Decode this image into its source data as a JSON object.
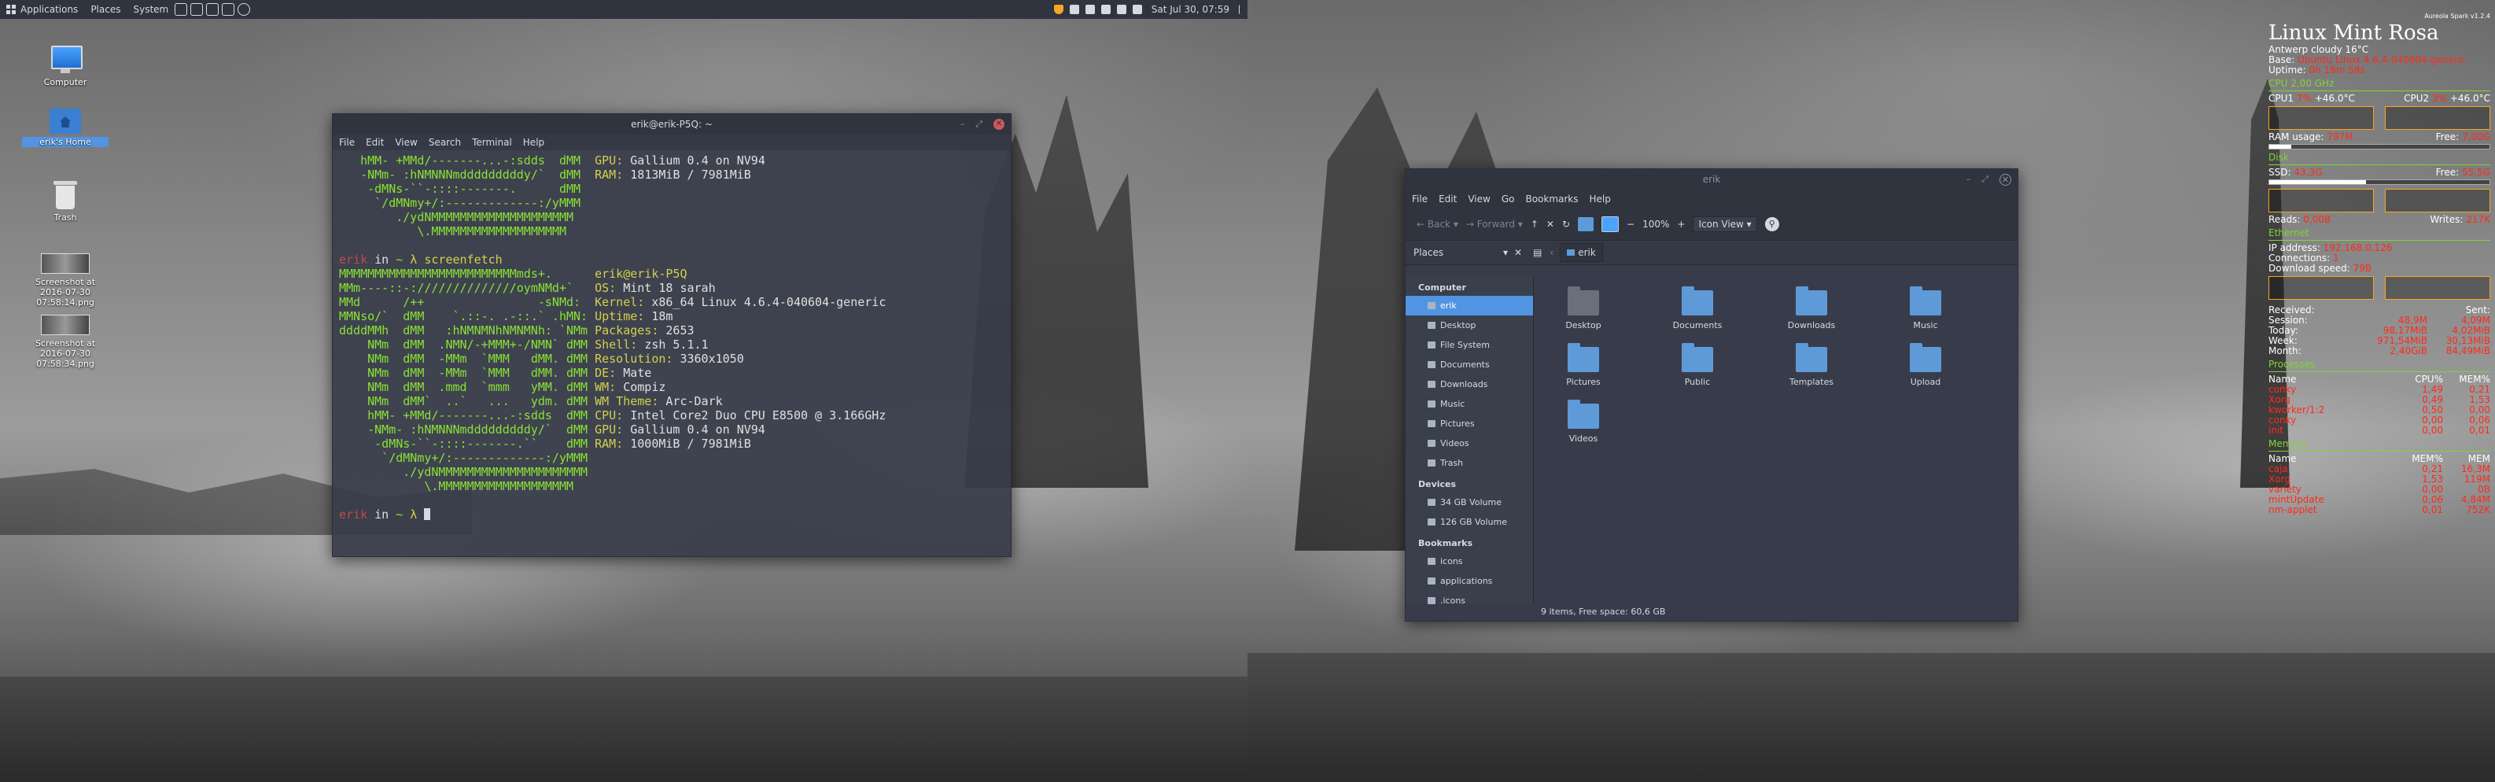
{
  "panel": {
    "applications": "Applications",
    "places": "Places",
    "system": "System",
    "clock": "Sat Jul 30, 07:59"
  },
  "desktop": {
    "icons": [
      {
        "label": "Computer"
      },
      {
        "label": "erik's Home"
      },
      {
        "label": "Trash"
      },
      {
        "label": "Screenshot at 2016-07-30 07:58:14.png"
      },
      {
        "label": "Screenshot at 2016-07-30 07:58:34.png"
      }
    ]
  },
  "terminal": {
    "title": "erik@erik-P5Q: ~",
    "menu": [
      "File",
      "Edit",
      "View",
      "Search",
      "Terminal",
      "Help"
    ],
    "top_lines": [
      [
        "   hMM- +MMd/-------...-:sdds  dMM  ",
        "GPU: ",
        "Gallium 0.4 on NV94"
      ],
      [
        "   -NMm- :hNMNNNmdddddddddy/`  dMM  ",
        "RAM: ",
        "1813MiB / 7981MiB"
      ],
      [
        "    -dMNs-``-::::-------.      dMM",
        "",
        ""
      ],
      [
        "     `/dMNmy+/:-------------:/yMMM",
        "",
        ""
      ],
      [
        "        ./ydNMMMMMMMMMMMMMMMMMMMM",
        "",
        ""
      ],
      [
        "           \\.MMMMMMMMMMMMMMMMMMM",
        "",
        ""
      ]
    ],
    "prompt1_user": "erik",
    "prompt1_mid": " in ",
    "prompt1_tilde": "~",
    "prompt1_cmd": " λ screenfetch",
    "userhost": "erik@erik-P5Q",
    "logo": [
      "MMMMMMMMMMMMMMMMMMMMMMMMMmds+.",
      "MMm----::-://////////////oymNMd+`",
      "MMd      /++                -sNMd:",
      "MMNso/`  dMM    `.::-. .-::.` .hMN:",
      "ddddMMh  dMM   :hNMNMNhNMNMNh: `NMm",
      "    NMm  dMM  .NMN/-+MMM+-/NMN` dMM",
      "    NMm  dMM  -MMm  `MMM   dMM. dMM",
      "    NMm  dMM  -MMm  `MMM   dMM. dMM",
      "    NMm  dMM  .mmd  `mmm   yMM. dMM",
      "    NMm  dMM`  ..`   ...   ydm. dMM",
      "    hMM- +MMd/-------...-:sdds  dMM",
      "    -NMm- :hNMNNNmdddddddddy/`  dMM",
      "     -dMNs-``-::::-------.``    dMM",
      "      `/dMNmy+/:-------------:/yMMM",
      "         ./ydNMMMMMMMMMMMMMMMMMMMMM",
      "            \\.MMMMMMMMMMMMMMMMMMM"
    ],
    "info": [
      [
        "",
        ""
      ],
      [
        "OS: ",
        "Mint 18 sarah"
      ],
      [
        "Kernel: ",
        "x86_64 Linux 4.6.4-040604-generic"
      ],
      [
        "Uptime: ",
        "18m"
      ],
      [
        "Packages: ",
        "2653"
      ],
      [
        "Shell: ",
        "zsh 5.1.1"
      ],
      [
        "Resolution: ",
        "3360x1050"
      ],
      [
        "DE: ",
        "Mate"
      ],
      [
        "WM: ",
        "Compiz"
      ],
      [
        "WM Theme: ",
        "Arc-Dark"
      ],
      [
        "CPU: ",
        "Intel Core2 Duo CPU E8500 @ 3.166GHz"
      ],
      [
        "GPU: ",
        "Gallium 0.4 on NV94"
      ],
      [
        "RAM: ",
        "1000MiB / 7981MiB"
      ],
      [
        "",
        ""
      ],
      [
        "",
        ""
      ],
      [
        "",
        ""
      ]
    ],
    "prompt2_user": "erik",
    "prompt2_mid": " in ",
    "prompt2_tilde": "~",
    "prompt2_lambda": " λ "
  },
  "filemanager": {
    "title": "erik",
    "menu": [
      "File",
      "Edit",
      "View",
      "Go",
      "Bookmarks",
      "Help"
    ],
    "back": "Back",
    "forward": "Forward",
    "zoom": "100%",
    "view_mode": "Icon View",
    "places_label": "Places",
    "path": "erik",
    "sections": [
      {
        "title": "Computer",
        "items": [
          "erik",
          "Desktop",
          "File System",
          "Documents",
          "Downloads",
          "Music",
          "Pictures",
          "Videos",
          "Trash"
        ]
      },
      {
        "title": "Devices",
        "items": [
          "34 GB Volume",
          "126 GB Volume"
        ]
      },
      {
        "title": "Bookmarks",
        "items": [
          "icons",
          "applications",
          ".icons"
        ]
      }
    ],
    "files": [
      "Desktop",
      "Documents",
      "Downloads",
      "Music",
      "Pictures",
      "Public",
      "Templates",
      "Upload",
      "Videos"
    ],
    "status": "9 items, Free space: 60,6 GB"
  },
  "conky": {
    "version": "Aureola Spark v1.2.4",
    "title": "Linux Mint Rosa",
    "location": "Antwerp",
    "weather": "cloudy 16°C",
    "base_label": "Base:",
    "base_value": "Ubuntu Linux 4.6.4-040604-generic",
    "uptime_label": "Uptime:",
    "uptime_value": "0h 18m 58s",
    "cpu_header": "CPU 2,00 GHz",
    "cpu1_label": "CPU1",
    "cpu1_pct": "7%",
    "cpu1_temp": "+46.0°C",
    "cpu2_label": "CPU2",
    "cpu2_pct": "3%",
    "cpu2_temp": "+46.0°C",
    "ram_label": "RAM usage:",
    "ram_value": "797M",
    "ram_free_label": "Free:",
    "ram_free_value": "7,00G",
    "ram_fill": 0.1,
    "disk_header": "Disk",
    "ssd_label": "SSD:",
    "ssd_value": "43,3G",
    "ssd_free_label": "Free:",
    "ssd_free_value": "55,5G",
    "ssd_fill": 0.44,
    "reads_label": "Reads:",
    "reads_value": "0,00B",
    "writes_label": "Writes:",
    "writes_value": "217K",
    "eth_header": "Ethernet",
    "ip_label": "IP address:",
    "ip_value": "192.168.0.126",
    "conn_label": "Connections:",
    "conn_value": "1",
    "dl_label": "Download speed:",
    "dl_value": "79B",
    "received_label": "Received:",
    "sent_label": "Sent:",
    "traffic": [
      [
        "Session:",
        "48,9M",
        "4,09M"
      ],
      [
        "Today:",
        "98,17MiB",
        "4,02MiB"
      ],
      [
        "Week:",
        "971,54MiB",
        "30,13MiB"
      ],
      [
        "Month:",
        "2,40GiB",
        "84,49MiB"
      ]
    ],
    "proc_header": "Processes",
    "proc_cols": [
      "Name",
      "CPU%",
      "MEM%"
    ],
    "processes": [
      [
        "conky",
        "1,49",
        "0,21"
      ],
      [
        "Xorg",
        "0,49",
        "1,53"
      ],
      [
        "kworker/1:2",
        "0,50",
        "0,00"
      ],
      [
        "conky",
        "0,00",
        "0,06"
      ],
      [
        "init",
        "0,00",
        "0,01"
      ]
    ],
    "mem_header": "Memory",
    "mem_cols": [
      "Name",
      "MEM%",
      "MEM"
    ],
    "memory": [
      [
        "caja",
        "0,21",
        "16,3M"
      ],
      [
        "Xorg",
        "1,53",
        "119M"
      ],
      [
        "variety",
        "0,00",
        "0B"
      ],
      [
        "mintUpdate",
        "0,06",
        "4,84M"
      ],
      [
        "nm-applet",
        "0,01",
        "752K"
      ]
    ]
  }
}
